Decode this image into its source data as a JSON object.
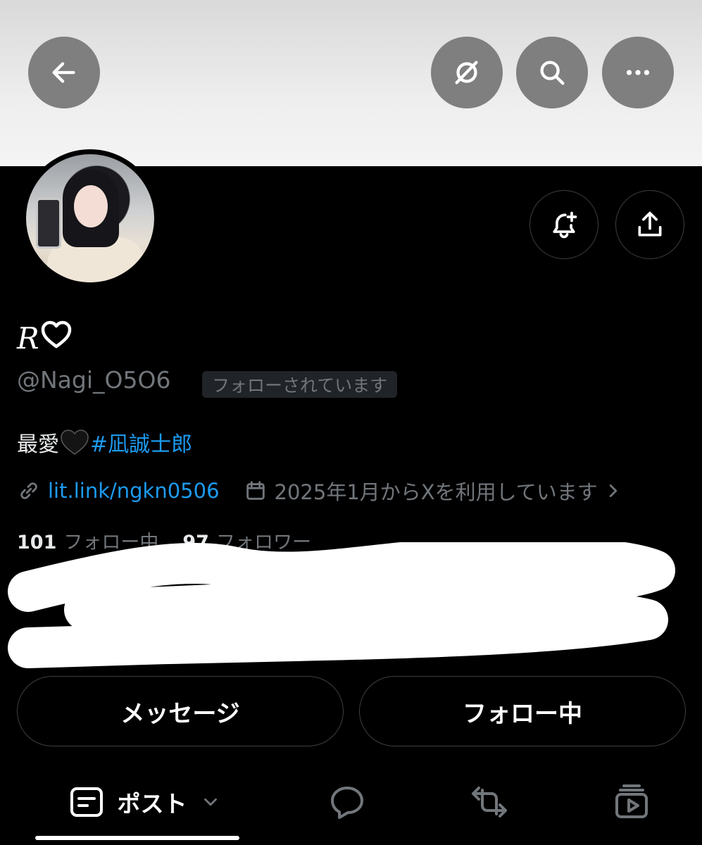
{
  "header": {
    "back_icon": "arrow-left-icon",
    "grok_icon": "grok-icon",
    "search_icon": "search-icon",
    "more_icon": "more-horizontal-icon"
  },
  "profile": {
    "display_name_letter": "R",
    "display_name_emoji": "♡",
    "handle": "@Nagi_O5O6",
    "follows_you": "フォローされています",
    "bio_text": "最愛",
    "bio_emoji": "🖤",
    "bio_hashtag": "#凪誠士郎",
    "link": "lit.link/ngkn0506",
    "joined": "2025年1月からXを利用しています",
    "following_count": "101",
    "following_label": "フォロー中",
    "followers_count": "97",
    "followers_label": "フォロワー"
  },
  "actions": {
    "message_label": "メッセージ",
    "following_label": "フォロー中",
    "notify_icon": "bell-plus-icon",
    "share_icon": "share-icon"
  },
  "tabs": {
    "posts_label": "ポスト",
    "posts_icon": "posts-icon",
    "replies_icon": "reply-bubble-icon",
    "reposts_icon": "repost-icon",
    "media_icon": "media-icon"
  },
  "colors": {
    "background": "#000000",
    "accent": "#1d9bf0",
    "muted": "#71767b",
    "text": "#e7e9ea"
  }
}
